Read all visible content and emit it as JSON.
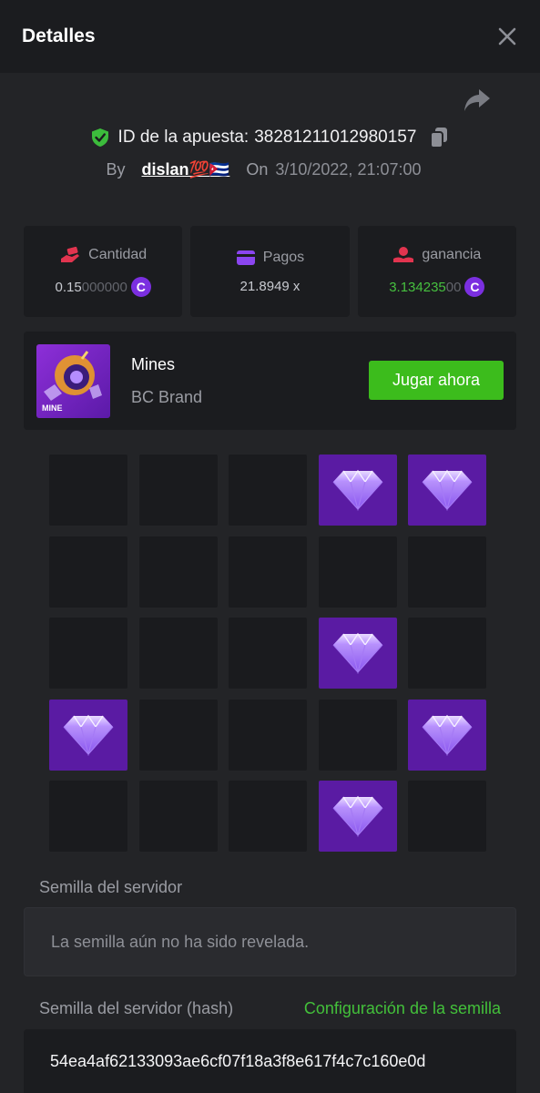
{
  "header": {
    "title": "Detalles"
  },
  "bet": {
    "id_label": "ID de la apuesta:",
    "id_value": "38281211012980157",
    "by_label": "By",
    "user": "dislan💯🇨🇺",
    "on_label": "On",
    "date": "3/10/2022, 21:07:00"
  },
  "stats": {
    "amount": {
      "label": "Cantidad",
      "value_main": "0.15",
      "value_dim": "000000",
      "coin": "C"
    },
    "payout": {
      "label": "Pagos",
      "value": "21.8949 x"
    },
    "profit": {
      "label": "ganancia",
      "value_main": "3.134235",
      "value_dim": "00",
      "coin": "C"
    }
  },
  "game": {
    "thumb_label": "MINE",
    "name": "Mines",
    "brand": "BC Brand",
    "play_label": "Jugar ahora"
  },
  "grid": {
    "rows": 5,
    "cols": 5,
    "tiles": [
      "empty",
      "empty",
      "empty",
      "gem",
      "gem",
      "empty",
      "empty",
      "empty",
      "empty",
      "empty",
      "empty",
      "empty",
      "empty",
      "gem",
      "empty",
      "gem",
      "empty",
      "empty",
      "empty",
      "gem",
      "empty",
      "empty",
      "empty",
      "gem",
      "empty"
    ]
  },
  "seeds": {
    "server_label": "Semilla del servidor",
    "server_value": "La semilla aún no ha sido revelada.",
    "hash_label": "Semilla del servidor (hash)",
    "config_label": "Configuración de la semilla",
    "hash_value": "54ea4af62133093ae6cf07f18a3f8e617f4c7c160e0d"
  },
  "colors": {
    "background": "#232427",
    "panel": "#1b1c1f",
    "gem_tile": "#5a1ba3",
    "accent_green": "#3cbc1c",
    "coin_purple": "#7b2fe0",
    "icon_red": "#e2344f",
    "icon_purple": "#8b45f0",
    "shield_green": "#3cbc3c"
  },
  "icons": {
    "close": "close-icon",
    "share": "share-icon",
    "shield": "shield-check-icon",
    "copy": "copy-icon",
    "amount": "money-hand-icon",
    "payout": "card-icon",
    "profit": "profit-hand-icon",
    "gem": "diamond-icon"
  }
}
